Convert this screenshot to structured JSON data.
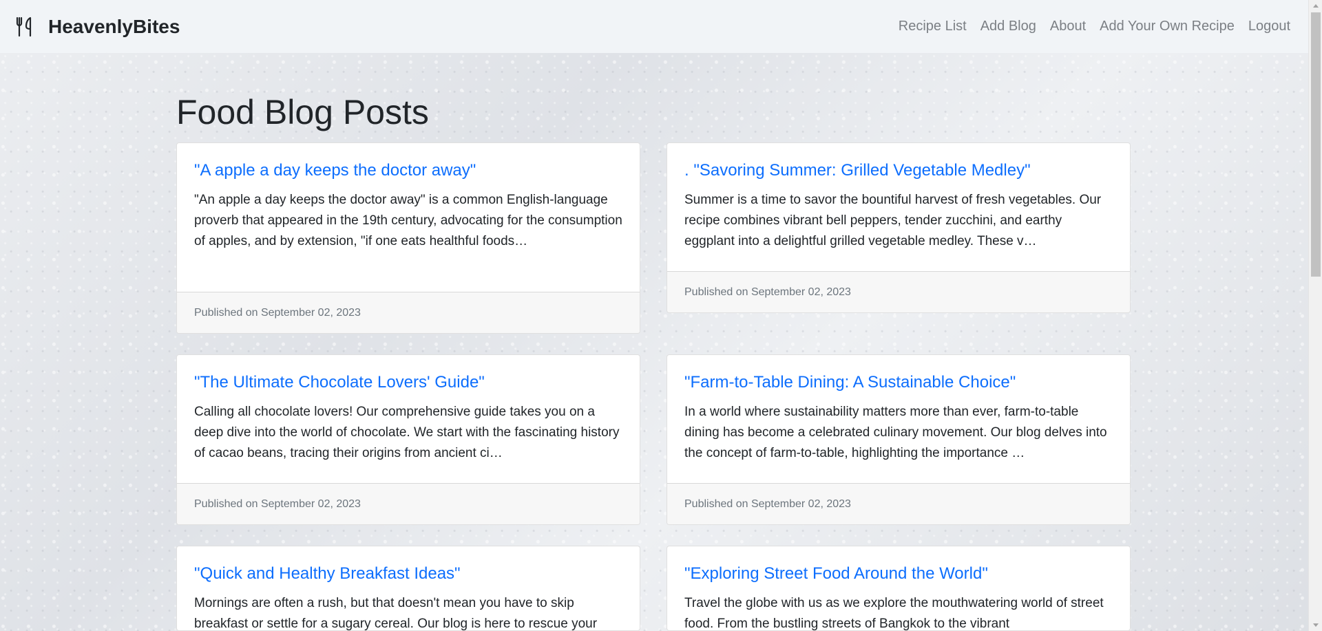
{
  "brand": {
    "name": "HeavenlyBites",
    "icon": "fork-knife-icon"
  },
  "nav": [
    {
      "label": "Recipe List"
    },
    {
      "label": "Add Blog"
    },
    {
      "label": "About"
    },
    {
      "label": "Add Your Own Recipe"
    },
    {
      "label": "Logout"
    }
  ],
  "page": {
    "title": "Food Blog Posts"
  },
  "posts": [
    {
      "title": "\"A apple a day keeps the doctor away\"",
      "excerpt": "\"An apple a day keeps the doctor away\" is a common English-language proverb that appeared in the 19th century, advocating for the consumption of apples, and by extension, \"if one eats healthful foods…",
      "footer": "Published on September 02, 2023"
    },
    {
      "title": ". \"Savoring Summer: Grilled Vegetable Medley\"",
      "excerpt": "Summer is a time to savor the bountiful harvest of fresh vegetables. Our recipe combines vibrant bell peppers, tender zucchini, and earthy eggplant into a delightful grilled vegetable medley. These v…",
      "footer": "Published on September 02, 2023"
    },
    {
      "title": "\"The Ultimate Chocolate Lovers' Guide\"",
      "excerpt": "Calling all chocolate lovers! Our comprehensive guide takes you on a deep dive into the world of chocolate. We start with the fascinating history of cacao beans, tracing their origins from ancient ci…",
      "footer": "Published on September 02, 2023"
    },
    {
      "title": "\"Farm-to-Table Dining: A Sustainable Choice\"",
      "excerpt": "In a world where sustainability matters more than ever, farm-to-table dining has become a celebrated culinary movement. Our blog delves into the concept of farm-to-table, highlighting the importance …",
      "footer": "Published on September 02, 2023"
    },
    {
      "title": "\"Quick and Healthy Breakfast Ideas\"",
      "excerpt": "Mornings are often a rush, but that doesn't mean you have to skip breakfast or settle for a sugary cereal. Our blog is here to rescue your",
      "footer": ""
    },
    {
      "title": "\"Exploring Street Food Around the World\"",
      "excerpt": "Travel the globe with us as we explore the mouthwatering world of street food. From the bustling streets of Bangkok to the vibrant",
      "footer": ""
    }
  ]
}
